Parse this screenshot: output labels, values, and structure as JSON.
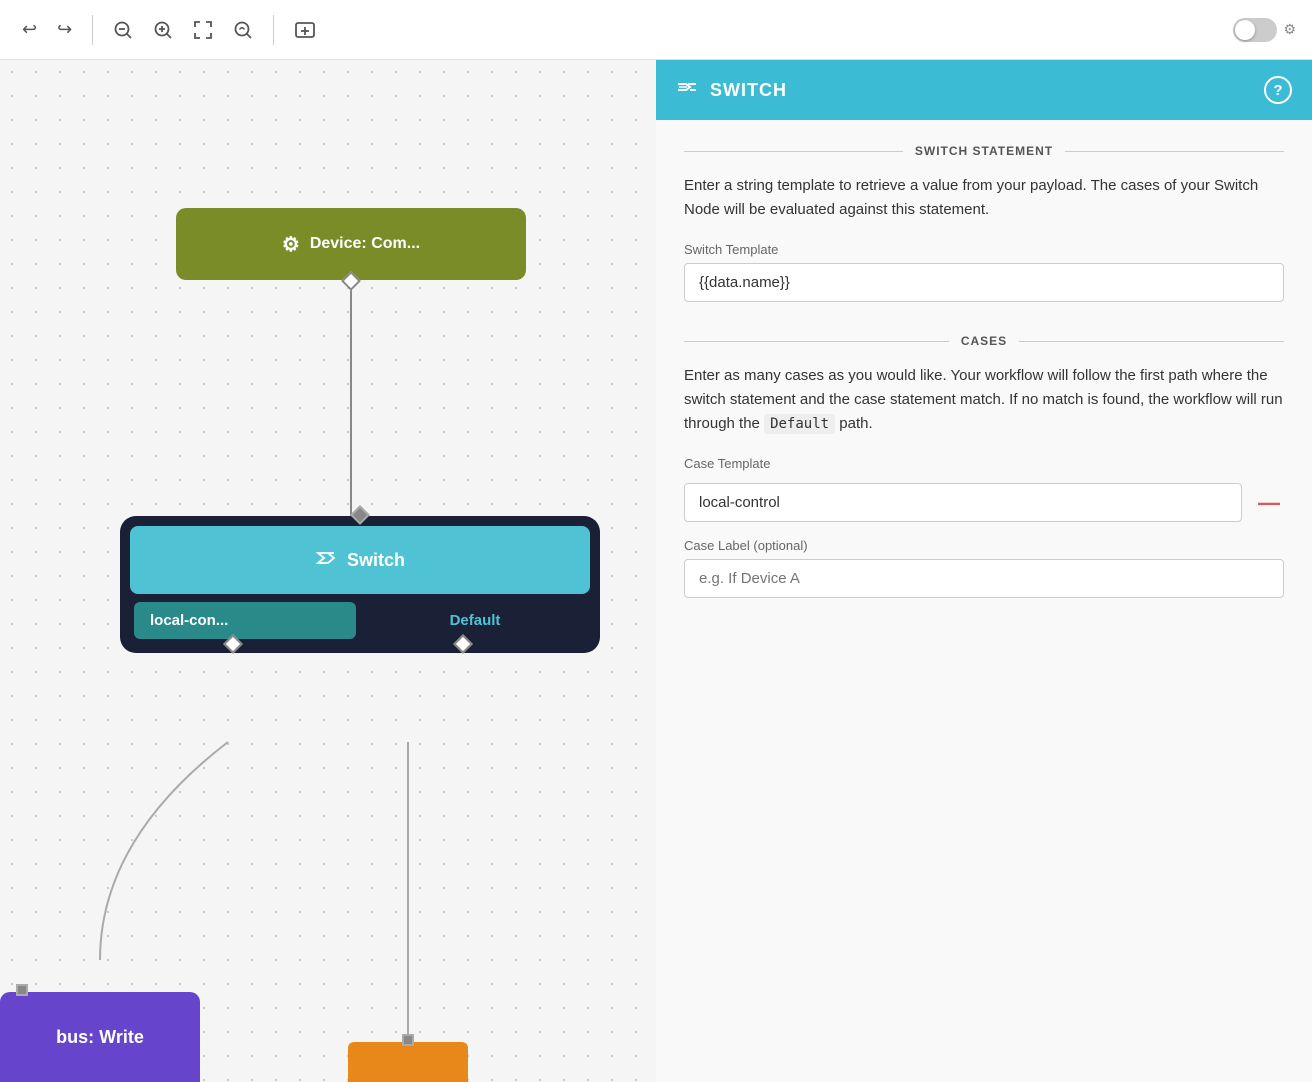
{
  "toolbar": {
    "undo_label": "↩",
    "redo_label": "↪",
    "zoom_out_label": "−",
    "zoom_in_label": "+",
    "fit_label": "⤢",
    "zoom_reset_label": "🔍",
    "add_label": "＋"
  },
  "canvas": {
    "device_node_label": "Device: Com...",
    "device_node_icon": "⚙",
    "switch_node_label": "Switch",
    "switch_node_icon": "⇄",
    "output_local_label": "local-con...",
    "output_default_label": "Default",
    "bus_node_label": "bus: Write",
    "orange_node_label": ""
  },
  "panel": {
    "title": "SWITCH",
    "title_icon": "⇄",
    "help_label": "?",
    "switch_statement_section": "SWITCH STATEMENT",
    "switch_description": "Enter a string template to retrieve a value from your payload. The cases of your Switch Node will be evaluated against this statement.",
    "switch_template_label": "Switch Template",
    "switch_template_value": "{{data.name}}",
    "cases_section": "CASES",
    "cases_description_1": "Enter as many cases as you would like. Your workflow will follow the first path where the switch statement and the case statement match. If no match is found, the workflow will run through the",
    "cases_default_code": "Default",
    "cases_description_2": "path.",
    "case_template_label": "Case Template",
    "case_template_value": "local-control",
    "case_label_label": "Case Label (optional)",
    "case_label_placeholder": "e.g. If Device A",
    "delete_label": "—"
  }
}
